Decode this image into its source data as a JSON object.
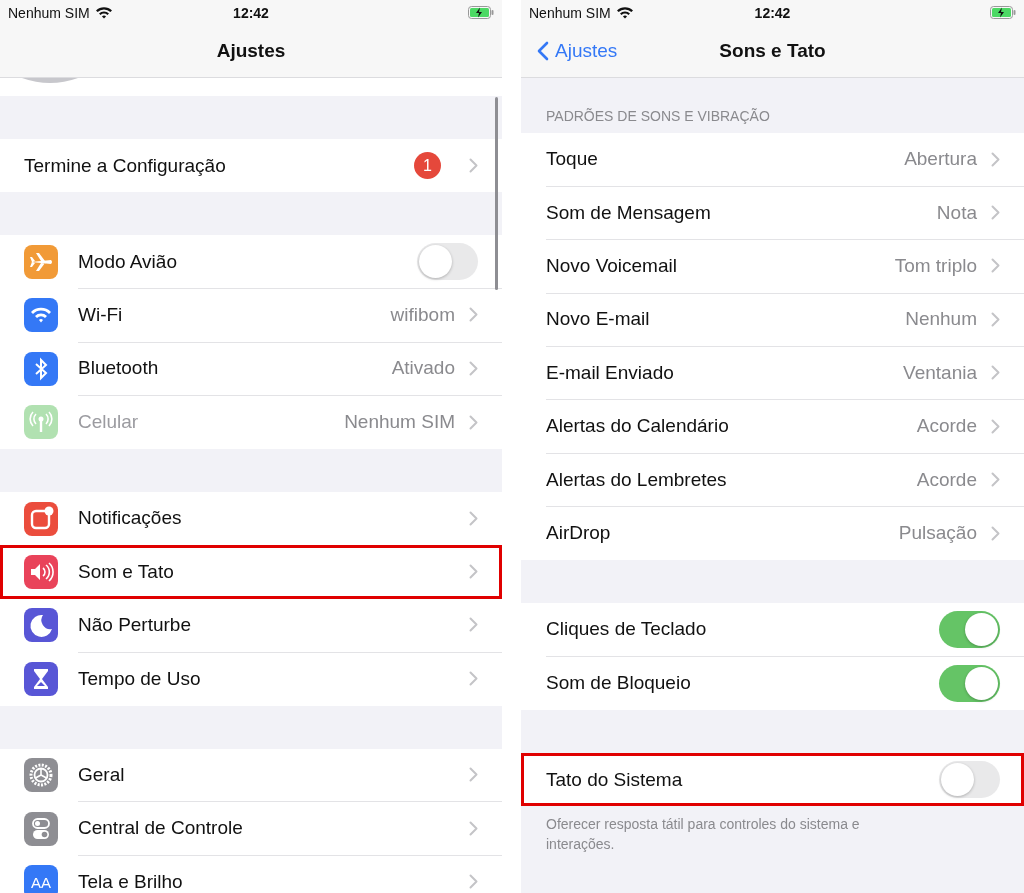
{
  "left_screen": {
    "status_bar": {
      "carrier": "Nenhum SIM",
      "time": "12:42"
    },
    "nav_bar": {
      "title": "Ajustes"
    },
    "groups": [
      {
        "rows": [
          {
            "kind": "badge",
            "label": "Termine a Configuração",
            "badge": "1",
            "disabled": false,
            "highlighted": false
          }
        ]
      },
      {
        "rows": [
          {
            "kind": "toggle",
            "label": "Modo Avião",
            "on": false,
            "disabled": false,
            "highlighted": false
          },
          {
            "kind": "link",
            "label": "Wi-Fi",
            "value": "wifibom",
            "disabled": false,
            "highlighted": false
          },
          {
            "kind": "link",
            "label": "Bluetooth",
            "value": "Ativado",
            "disabled": false,
            "highlighted": false
          },
          {
            "kind": "link",
            "label": "Celular",
            "value": "Nenhum SIM",
            "disabled": true,
            "highlighted": false
          }
        ]
      },
      {
        "rows": [
          {
            "kind": "link",
            "label": "Notificações",
            "disabled": false,
            "highlighted": false
          },
          {
            "kind": "link",
            "label": "Som e Tato",
            "disabled": false,
            "highlighted": true
          },
          {
            "kind": "link",
            "label": "Não Perturbe",
            "disabled": false,
            "highlighted": false
          },
          {
            "kind": "link",
            "label": "Tempo de Uso",
            "disabled": false,
            "highlighted": false
          }
        ]
      },
      {
        "rows": [
          {
            "kind": "link",
            "label": "Geral",
            "disabled": false,
            "highlighted": false
          },
          {
            "kind": "link",
            "label": "Central de Controle",
            "disabled": false,
            "highlighted": false
          },
          {
            "kind": "link",
            "icon_text": "AA",
            "label": "Tela e Brilho",
            "disabled": false,
            "highlighted": false
          }
        ]
      }
    ]
  },
  "right_screen": {
    "status_bar": {
      "carrier": "Nenhum SIM",
      "time": "12:42"
    },
    "nav_bar": {
      "back": "Ajustes",
      "title": "Sons e Tato"
    },
    "groups": [
      {
        "header": "PADRÕES DE SONS E VIBRAÇÃO",
        "rows": [
          {
            "kind": "link",
            "label": "Toque",
            "value": "Abertura",
            "highlighted": false
          },
          {
            "kind": "link",
            "label": "Som de Mensagem",
            "value": "Nota",
            "highlighted": false
          },
          {
            "kind": "link",
            "label": "Novo Voicemail",
            "value": "Tom triplo",
            "highlighted": false
          },
          {
            "kind": "link",
            "label": "Novo E-mail",
            "value": "Nenhum",
            "highlighted": false
          },
          {
            "kind": "link",
            "label": "E-mail Enviado",
            "value": "Ventania",
            "highlighted": false
          },
          {
            "kind": "link",
            "label": "Alertas do Calendário",
            "value": "Acorde",
            "highlighted": false
          },
          {
            "kind": "link",
            "label": "Alertas do Lembretes",
            "value": "Acorde",
            "highlighted": false
          },
          {
            "kind": "link",
            "label": "AirDrop",
            "value": "Pulsação",
            "highlighted": false
          }
        ]
      },
      {
        "rows": [
          {
            "kind": "toggle",
            "label": "Cliques de Teclado",
            "on": true,
            "highlighted": false
          },
          {
            "kind": "toggle",
            "label": "Som de Bloqueio",
            "on": true,
            "highlighted": false
          }
        ]
      },
      {
        "rows": [
          {
            "kind": "toggle",
            "label": "Tato do Sistema",
            "on": false,
            "highlighted": true
          }
        ],
        "footer": "Oferecer resposta tátil para controles do sistema e interações."
      }
    ]
  }
}
